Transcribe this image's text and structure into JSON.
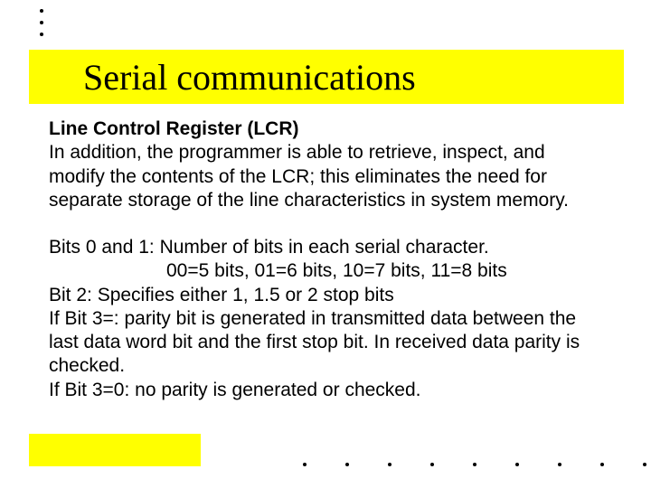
{
  "title": "Serial communications",
  "subtitle": "Line Control Register (LCR)",
  "para1": "In addition, the programmer is able to retrieve, inspect, and modify the contents of the LCR; this eliminates the need for separate storage of the line characteristics in system memory.",
  "para2_line1": "Bits 0 and 1: Number of bits in each serial character.",
  "para2_line2": "00=5 bits, 01=6 bits, 10=7 bits, 11=8 bits",
  "para2_line3": "Bit 2: Specifies either 1, 1.5 or 2 stop bits",
  "para2_line4": "If Bit 3=: parity bit is generated in transmitted data between the last data word bit and the first stop bit. In received data parity is checked.",
  "para2_line5": "If Bit 3=0: no parity is generated or checked."
}
